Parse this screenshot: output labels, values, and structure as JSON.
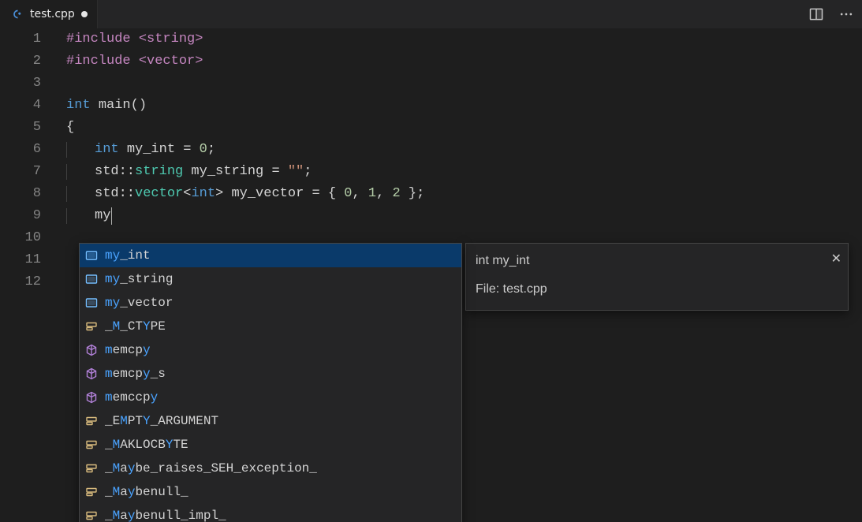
{
  "tab": {
    "filename": "test.cpp",
    "language_icon": "cpp-icon",
    "dirty": true
  },
  "editor": {
    "lines": [
      {
        "n": 1,
        "tokens": [
          {
            "t": "#include ",
            "c": "directive"
          },
          {
            "t": "<",
            "c": "angle"
          },
          {
            "t": "string",
            "c": "hdr"
          },
          {
            "t": ">",
            "c": "angle"
          }
        ]
      },
      {
        "n": 2,
        "tokens": [
          {
            "t": "#include ",
            "c": "directive"
          },
          {
            "t": "<",
            "c": "angle"
          },
          {
            "t": "vector",
            "c": "hdr"
          },
          {
            "t": ">",
            "c": "angle"
          }
        ]
      },
      {
        "n": 3,
        "tokens": []
      },
      {
        "n": 4,
        "tokens": [
          {
            "t": "int ",
            "c": "kw"
          },
          {
            "t": "main",
            "c": "id"
          },
          {
            "t": "()",
            "c": "punc"
          }
        ]
      },
      {
        "n": 5,
        "tokens": [
          {
            "t": "{",
            "c": "punc"
          }
        ]
      },
      {
        "n": 6,
        "guide": true,
        "indent": 1,
        "tokens": [
          {
            "t": "int ",
            "c": "kw"
          },
          {
            "t": "my_int ",
            "c": "id"
          },
          {
            "t": "= ",
            "c": "op"
          },
          {
            "t": "0",
            "c": "num"
          },
          {
            "t": ";",
            "c": "punc"
          }
        ]
      },
      {
        "n": 7,
        "guide": true,
        "indent": 1,
        "tokens": [
          {
            "t": "std",
            "c": "id"
          },
          {
            "t": "::",
            "c": "punc"
          },
          {
            "t": "string",
            "c": "type"
          },
          {
            "t": " my_string ",
            "c": "id"
          },
          {
            "t": "= ",
            "c": "op"
          },
          {
            "t": "\"\"",
            "c": "str"
          },
          {
            "t": ";",
            "c": "punc"
          }
        ]
      },
      {
        "n": 8,
        "guide": true,
        "indent": 1,
        "tokens": [
          {
            "t": "std",
            "c": "id"
          },
          {
            "t": "::",
            "c": "punc"
          },
          {
            "t": "vector",
            "c": "type"
          },
          {
            "t": "<",
            "c": "punc"
          },
          {
            "t": "int",
            "c": "kw"
          },
          {
            "t": ">",
            "c": "punc"
          },
          {
            "t": " my_vector ",
            "c": "id"
          },
          {
            "t": "= ",
            "c": "op"
          },
          {
            "t": "{ ",
            "c": "punc"
          },
          {
            "t": "0",
            "c": "num"
          },
          {
            "t": ", ",
            "c": "punc"
          },
          {
            "t": "1",
            "c": "num"
          },
          {
            "t": ", ",
            "c": "punc"
          },
          {
            "t": "2",
            "c": "num"
          },
          {
            "t": " };",
            "c": "punc"
          }
        ]
      },
      {
        "n": 9,
        "guide": true,
        "indent": 1,
        "tokens": [
          {
            "t": "my",
            "c": "id"
          }
        ],
        "cursor": true
      },
      {
        "n": 10,
        "tokens": []
      },
      {
        "n": 11,
        "tokens": []
      },
      {
        "n": 12,
        "tokens": []
      }
    ]
  },
  "suggest": {
    "items": [
      {
        "icon": "variable",
        "parts": [
          {
            "t": "my",
            "hl": true
          },
          {
            "t": "_int",
            "hl": false
          }
        ],
        "selected": true
      },
      {
        "icon": "variable",
        "parts": [
          {
            "t": "my",
            "hl": true
          },
          {
            "t": "_string",
            "hl": false
          }
        ]
      },
      {
        "icon": "variable",
        "parts": [
          {
            "t": "my",
            "hl": true
          },
          {
            "t": "_vector",
            "hl": false
          }
        ]
      },
      {
        "icon": "constant",
        "parts": [
          {
            "t": "_",
            "hl": false
          },
          {
            "t": "M",
            "hl": true
          },
          {
            "t": "_CT",
            "hl": false
          },
          {
            "t": "Y",
            "hl": true
          },
          {
            "t": "PE",
            "hl": false
          }
        ]
      },
      {
        "icon": "method",
        "parts": [
          {
            "t": "m",
            "hl": true
          },
          {
            "t": "emcp",
            "hl": false
          },
          {
            "t": "y",
            "hl": true
          }
        ]
      },
      {
        "icon": "method",
        "parts": [
          {
            "t": "m",
            "hl": true
          },
          {
            "t": "emcp",
            "hl": false
          },
          {
            "t": "y",
            "hl": true
          },
          {
            "t": "_s",
            "hl": false
          }
        ]
      },
      {
        "icon": "method",
        "parts": [
          {
            "t": "m",
            "hl": true
          },
          {
            "t": "emccp",
            "hl": false
          },
          {
            "t": "y",
            "hl": true
          }
        ]
      },
      {
        "icon": "constant",
        "parts": [
          {
            "t": "_E",
            "hl": false
          },
          {
            "t": "M",
            "hl": true
          },
          {
            "t": "PT",
            "hl": false
          },
          {
            "t": "Y",
            "hl": true
          },
          {
            "t": "_ARGUMENT",
            "hl": false
          }
        ]
      },
      {
        "icon": "constant",
        "parts": [
          {
            "t": "_",
            "hl": false
          },
          {
            "t": "M",
            "hl": true
          },
          {
            "t": "AKLOCB",
            "hl": false
          },
          {
            "t": "Y",
            "hl": true
          },
          {
            "t": "TE",
            "hl": false
          }
        ]
      },
      {
        "icon": "constant",
        "parts": [
          {
            "t": "_",
            "hl": false
          },
          {
            "t": "M",
            "hl": true
          },
          {
            "t": "a",
            "hl": false
          },
          {
            "t": "y",
            "hl": true
          },
          {
            "t": "be_raises_SEH_exception_",
            "hl": false
          }
        ]
      },
      {
        "icon": "constant",
        "parts": [
          {
            "t": "_",
            "hl": false
          },
          {
            "t": "M",
            "hl": true
          },
          {
            "t": "a",
            "hl": false
          },
          {
            "t": "y",
            "hl": true
          },
          {
            "t": "benull_",
            "hl": false
          }
        ]
      },
      {
        "icon": "constant",
        "parts": [
          {
            "t": "_",
            "hl": false
          },
          {
            "t": "M",
            "hl": true
          },
          {
            "t": "a",
            "hl": false
          },
          {
            "t": "y",
            "hl": true
          },
          {
            "t": "benull_impl_",
            "hl": false
          }
        ]
      }
    ]
  },
  "detail": {
    "signature": "int my_int",
    "file_label": "File: test.cpp"
  },
  "icons": {
    "cpp": "C+",
    "split": "split-editor",
    "more": "more"
  }
}
